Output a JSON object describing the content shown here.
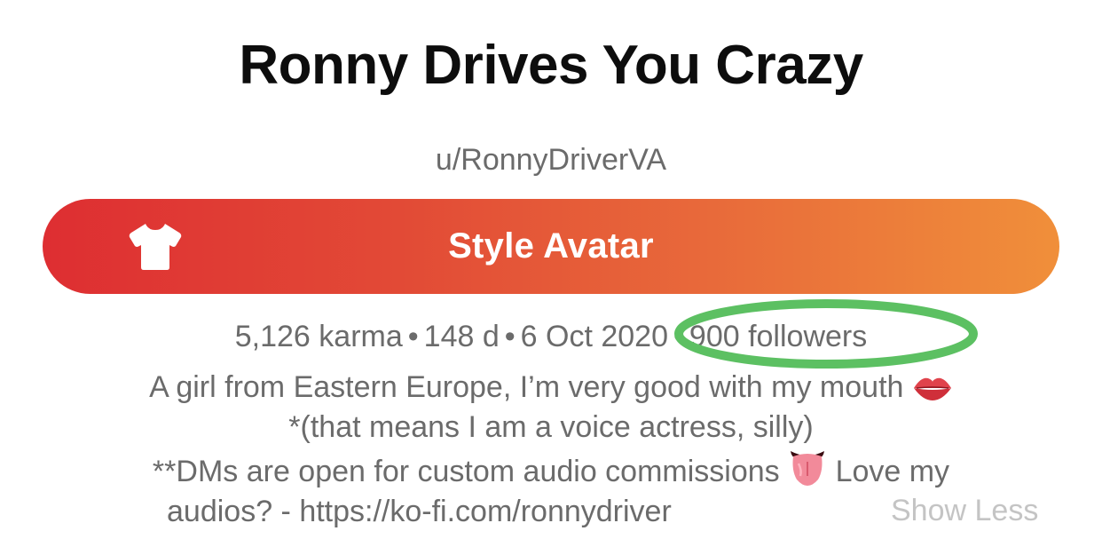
{
  "profile": {
    "display_name": "Ronny Drives You Crazy",
    "username": "u/RonnyDriverVA"
  },
  "style_avatar": {
    "label": "Style Avatar",
    "icon": "tshirt-icon",
    "gradient": [
      "#de2e32",
      "#f08f3a"
    ]
  },
  "stats": {
    "karma": "5,126 karma",
    "age": "148 d",
    "date": "6 Oct 2020",
    "followers": "900 followers",
    "separator": "•"
  },
  "highlight": {
    "color": "#5cc062"
  },
  "bio": {
    "line1": "A girl from Eastern Europe, I’m very good with my mouth",
    "line2": "*(that means I am a voice actress, silly)",
    "line3": "**DMs are open for custom audio commissions",
    "line3_suffix": "Love my",
    "line4": "audios? - https://ko-fi.com/ronnydriver",
    "emojis": [
      "lips-emoji",
      "tongue-emoji"
    ]
  },
  "show_less": "Show Less"
}
